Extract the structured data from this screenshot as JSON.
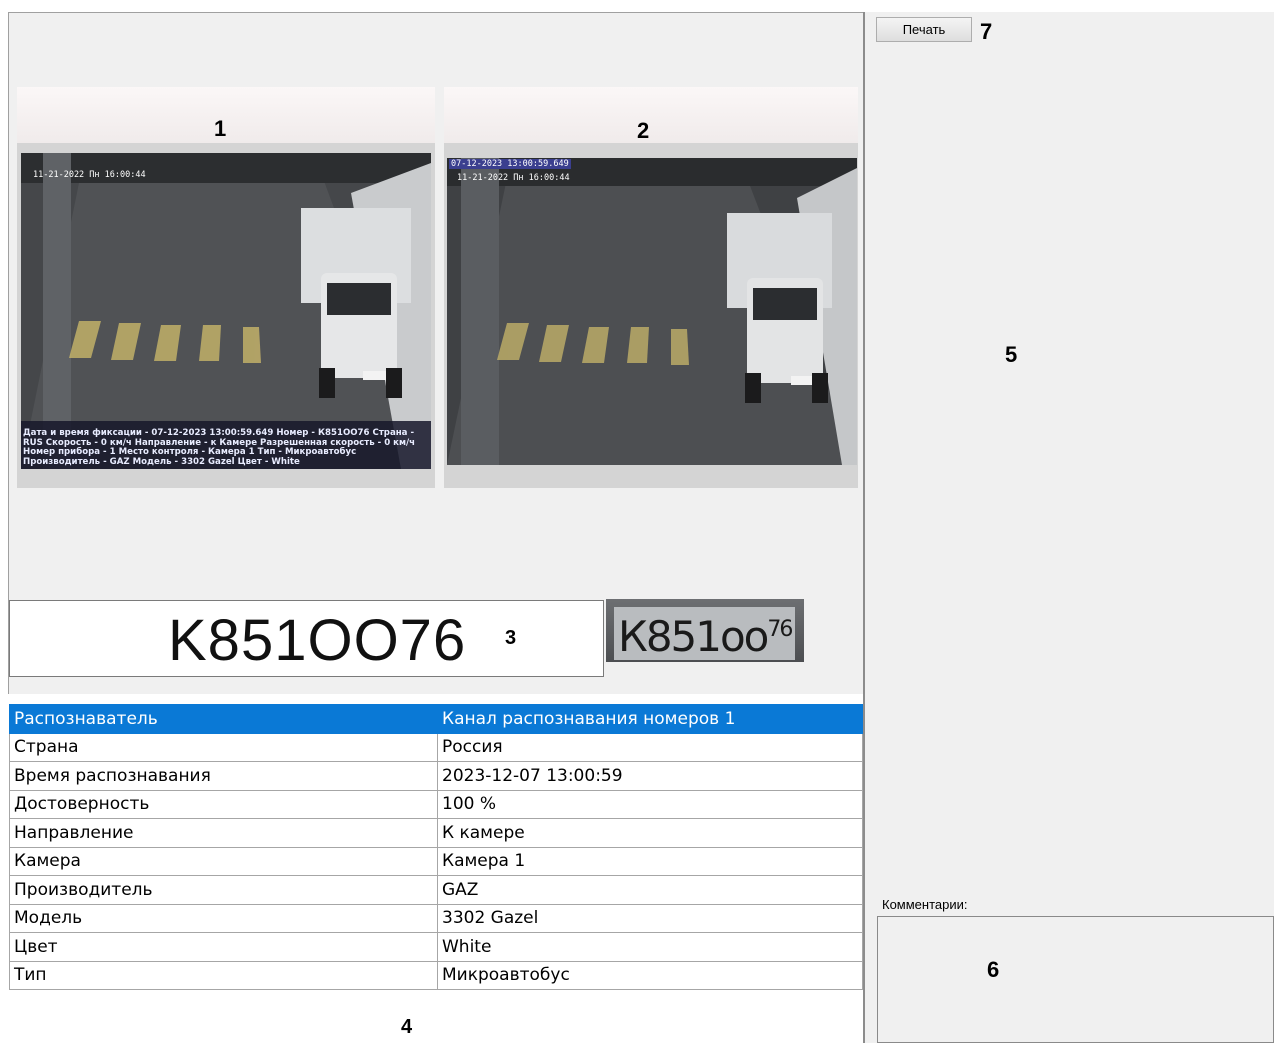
{
  "markers": {
    "m1": "1",
    "m2": "2",
    "m3": "3",
    "m4": "4",
    "m5": "5",
    "m6": "6",
    "m7": "7"
  },
  "photo1": {
    "timestamp": "11-21-2022 Пн 16:00:44",
    "overlay": "Дата и время фиксации - 07-12-2023 13:00:59.649 Номер - К851ОО76 Страна - RUS Скорость - 0 км/ч Направление - к Камере Разрешенная скорость - 0 км/ч Номер прибора - 1 Место контроля - Камера 1 Тип - Микроавтобус Производитель - GAZ Модель - 3302 Gazel Цвет - White"
  },
  "photo2": {
    "timestamp_top": "07-12-2023 13:00:59.649",
    "timestamp": "11-21-2022 Пн 16:00:44"
  },
  "plate": {
    "text": "K851OO76",
    "crop_text": "К851оо",
    "crop_region": "76"
  },
  "table": {
    "rows": [
      {
        "key": "Распознаватель",
        "value": "Канал распознавания номеров 1"
      },
      {
        "key": "Страна",
        "value": "Россия"
      },
      {
        "key": "Время распознавания",
        "value": "2023-12-07 13:00:59"
      },
      {
        "key": "Достоверность",
        "value": "100 %"
      },
      {
        "key": "Направление",
        "value": "К камере"
      },
      {
        "key": "Камера",
        "value": "Камера 1"
      },
      {
        "key": "Производитель",
        "value": "GAZ"
      },
      {
        "key": "Модель",
        "value": "3302 Gazel"
      },
      {
        "key": "Цвет",
        "value": "White"
      },
      {
        "key": "Тип",
        "value": "Микроавтобус"
      }
    ]
  },
  "print_label": "Печать",
  "comments_label": "Комментарии:",
  "colors": {
    "selection": "#0a79d6",
    "panel": "#f0f0f0"
  }
}
